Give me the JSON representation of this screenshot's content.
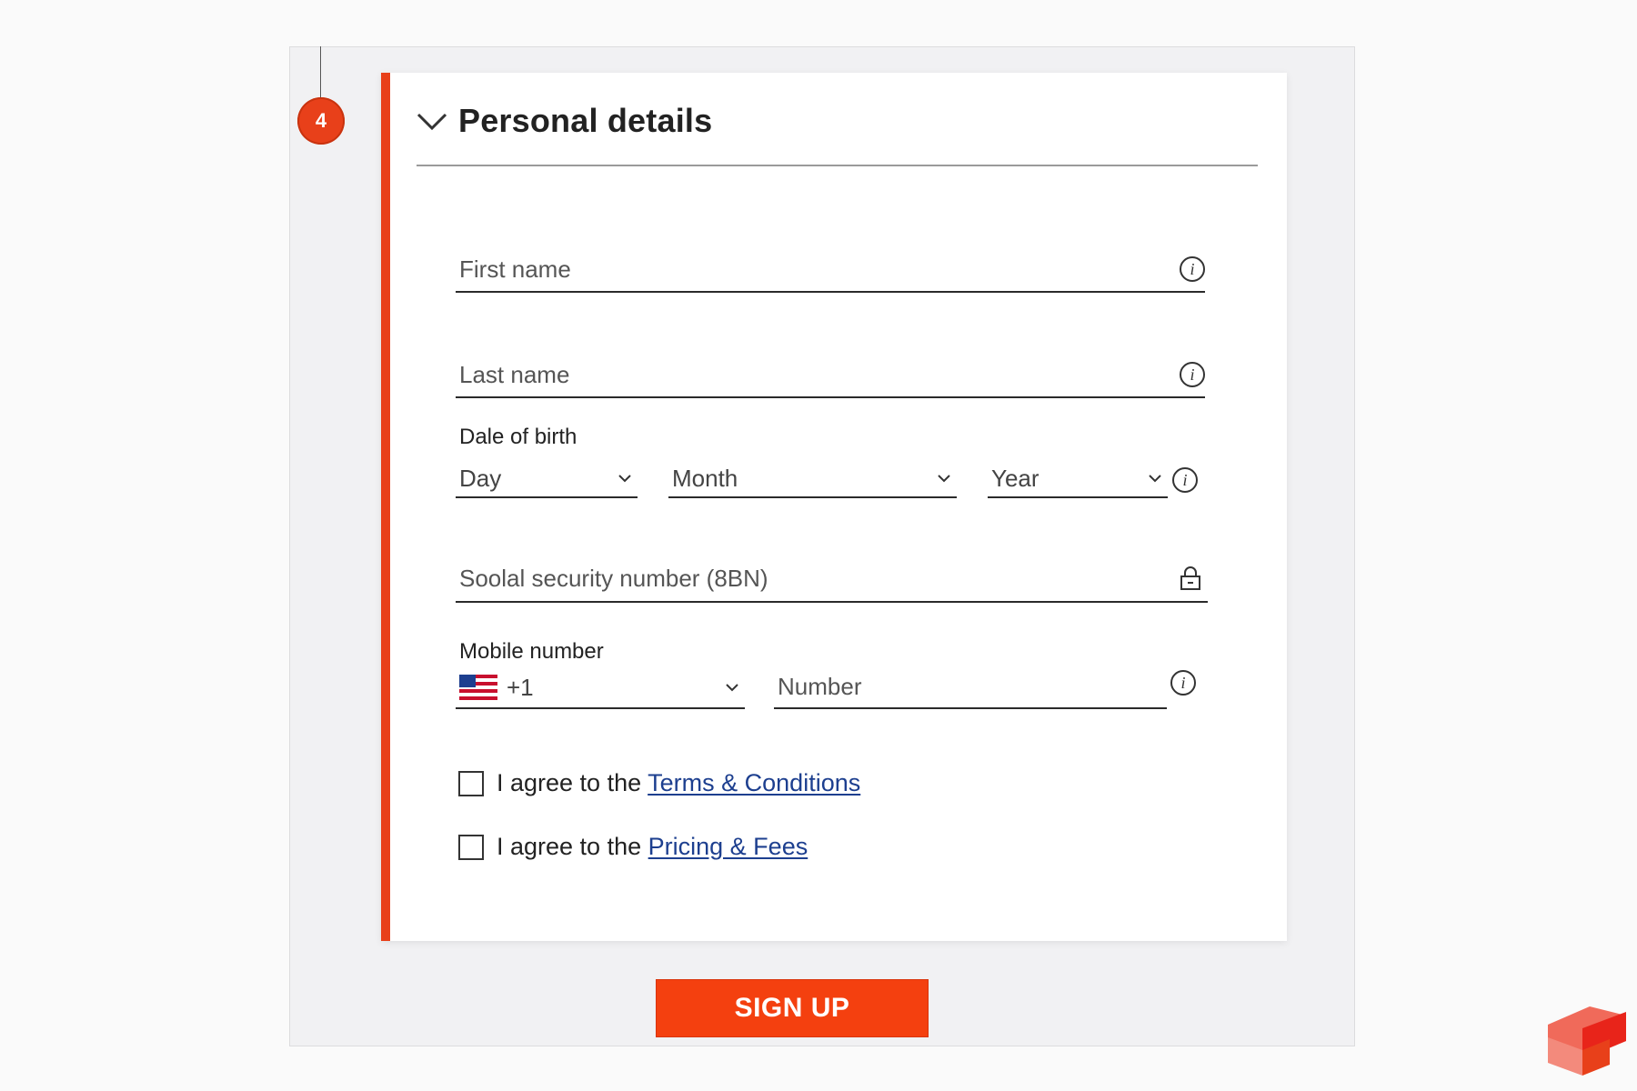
{
  "step": {
    "number": "4"
  },
  "section": {
    "title": "Personal details"
  },
  "fields": {
    "first_name": {
      "placeholder": "First name"
    },
    "last_name": {
      "placeholder": "Last name"
    },
    "dob": {
      "label": "Dale of birth",
      "day": "Day",
      "month": "Month",
      "year": "Year"
    },
    "ssn": {
      "placeholder": "Soolal security number (8BN)"
    },
    "mobile": {
      "label": "Mobile number",
      "country_code": "+1",
      "number_placeholder": "Number"
    }
  },
  "agreements": [
    {
      "prefix": "I agree to the",
      "link": "Terms & Conditions"
    },
    {
      "prefix": "I agree to the",
      "link": "Pricing & Fees"
    }
  ],
  "actions": {
    "signup": "SIGN UP"
  },
  "icons": {
    "collapse": "chevron-down-icon",
    "info": "info-icon",
    "lock": "lock-icon",
    "flag": "us-flag-icon"
  },
  "colors": {
    "accent": "#e8401a",
    "button": "#f4400f",
    "link": "#1d3f8f"
  }
}
